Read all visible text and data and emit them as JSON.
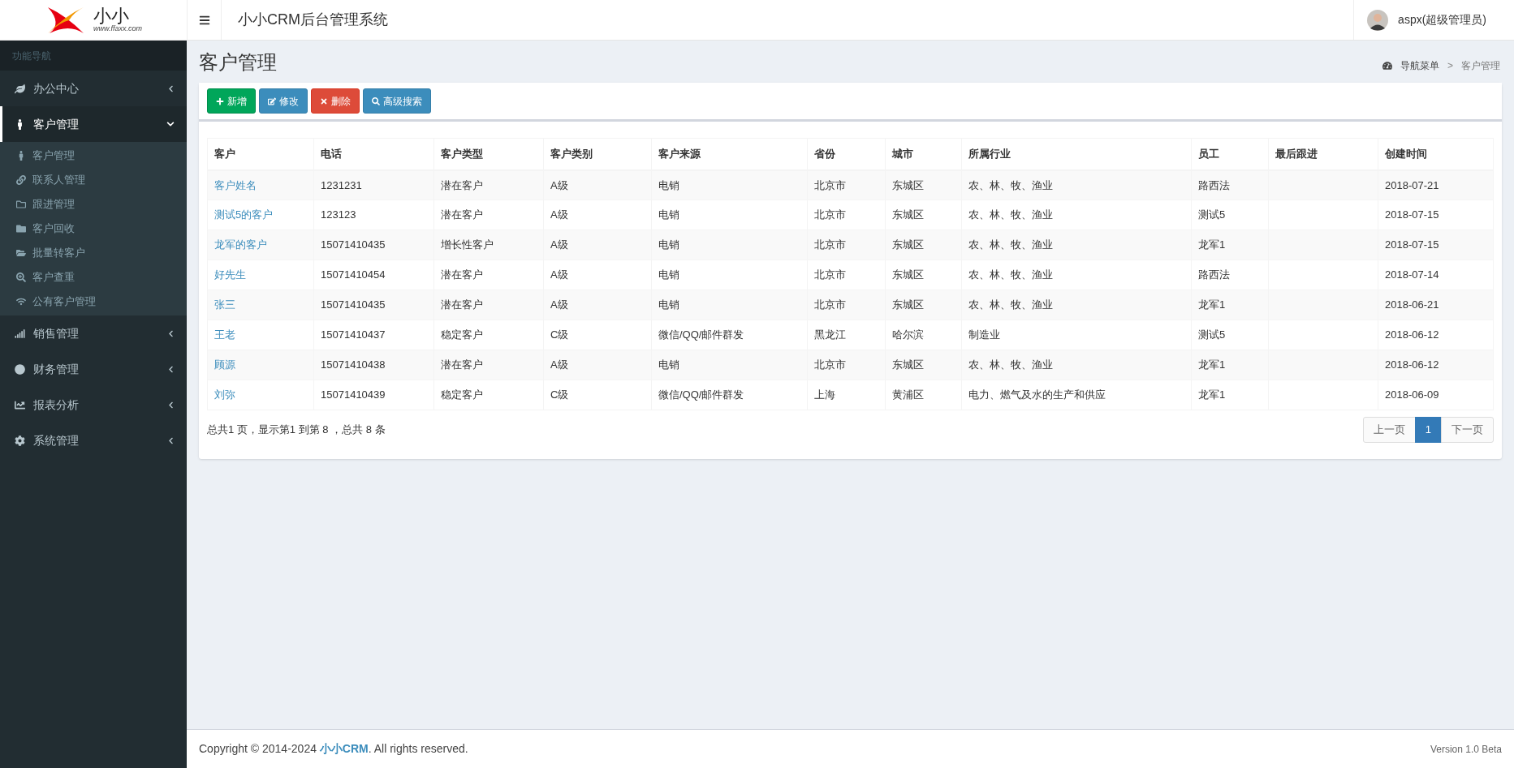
{
  "logo": {
    "text": "小小",
    "tagline": "www.ffaxx.com"
  },
  "header": {
    "title": "小小CRM后台管理系统",
    "user": "aspx(超级管理员)"
  },
  "sidebar": {
    "heading": "功能导航",
    "items": [
      {
        "label": "办公中心",
        "expanded": false,
        "selected": false
      },
      {
        "label": "客户管理",
        "expanded": true,
        "selected": true,
        "children": [
          {
            "label": "客户管理"
          },
          {
            "label": "联系人管理"
          },
          {
            "label": "跟进管理"
          },
          {
            "label": "客户回收"
          },
          {
            "label": "批量转客户"
          },
          {
            "label": "客户查重"
          },
          {
            "label": "公有客户管理"
          }
        ]
      },
      {
        "label": "销售管理",
        "expanded": false,
        "selected": false
      },
      {
        "label": "财务管理",
        "expanded": false,
        "selected": false
      },
      {
        "label": "报表分析",
        "expanded": false,
        "selected": false
      },
      {
        "label": "系统管理",
        "expanded": false,
        "selected": false
      }
    ]
  },
  "page": {
    "title": "客户管理",
    "breadcrumb": [
      "导航菜单",
      ">",
      "客户管理"
    ]
  },
  "toolbar": [
    {
      "kind": "add",
      "label": "新增"
    },
    {
      "kind": "edit",
      "label": "修改"
    },
    {
      "kind": "delete",
      "label": "删除"
    },
    {
      "kind": "search",
      "label": "高级搜索"
    }
  ],
  "table": {
    "columns": [
      "客户",
      "电话",
      "客户类型",
      "客户类别",
      "客户来源",
      "省份",
      "城市",
      "所属行业",
      "员工",
      "最后跟进",
      "创建时间"
    ],
    "rows": [
      [
        "客户姓名",
        "1231231",
        "潜在客户",
        "A级",
        "电销",
        "北京市",
        "东城区",
        "农、林、牧、渔业",
        "路西法",
        "",
        "2018-07-21"
      ],
      [
        "测试5的客户",
        "123123",
        "潜在客户",
        "A级",
        "电销",
        "北京市",
        "东城区",
        "农、林、牧、渔业",
        "测试5",
        "",
        "2018-07-15"
      ],
      [
        "龙军的客户",
        "15071410435",
        "增长性客户",
        "A级",
        "电销",
        "北京市",
        "东城区",
        "农、林、牧、渔业",
        "龙军1",
        "",
        "2018-07-15"
      ],
      [
        "好先生",
        "15071410454",
        "潜在客户",
        "A级",
        "电销",
        "北京市",
        "东城区",
        "农、林、牧、渔业",
        "路西法",
        "",
        "2018-07-14"
      ],
      [
        "张三",
        "15071410435",
        "潜在客户",
        "A级",
        "电销",
        "北京市",
        "东城区",
        "农、林、牧、渔业",
        "龙军1",
        "",
        "2018-06-21"
      ],
      [
        "王老",
        "15071410437",
        "稳定客户",
        "C级",
        "微信/QQ/邮件群发",
        "黑龙江",
        "哈尔滨",
        "制造业",
        "测试5",
        "",
        "2018-06-12"
      ],
      [
        "顾源",
        "15071410438",
        "潜在客户",
        "A级",
        "电销",
        "北京市",
        "东城区",
        "农、林、牧、渔业",
        "龙军1",
        "",
        "2018-06-12"
      ],
      [
        "刘弥",
        "15071410439",
        "稳定客户",
        "C级",
        "微信/QQ/邮件群发",
        "上海",
        "黄浦区",
        "电力、燃气及水的生产和供应",
        "龙军1",
        "",
        "2018-06-09"
      ]
    ]
  },
  "summary": "总共1 页，显示第1 到第 8 ，总共 8 条",
  "pagination": [
    {
      "label": "上一页",
      "selected": false
    },
    {
      "label": "1",
      "selected": true
    },
    {
      "label": "下一页",
      "selected": false
    }
  ],
  "footer": {
    "copyright": "Copyright © 2014-2024 **小小CRM**. All rights reserved.",
    "version": "Version 1.0 Beta"
  }
}
